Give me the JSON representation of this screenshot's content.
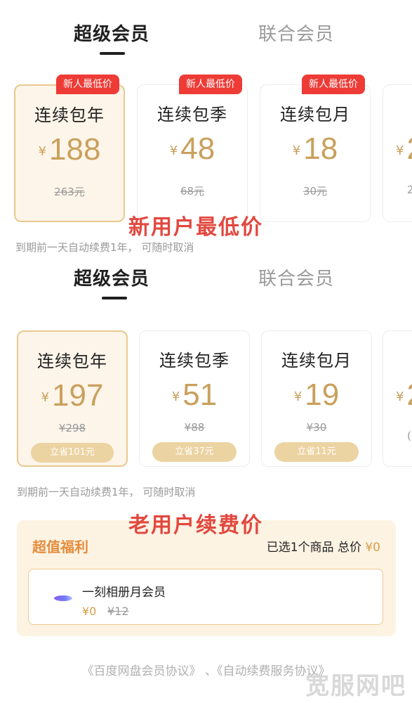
{
  "colors": {
    "gold": "#c9a05c",
    "badge_red": "#ee3b36",
    "overlay_red": "#e2483f",
    "selected_bg": "#fdf5e9",
    "benefit_bg": "#fdf3e3",
    "benefit_title": "#e58c3c"
  },
  "section_new": {
    "tabs": {
      "active": "超级会员",
      "inactive": "联合会员"
    },
    "badge": "新人最低价",
    "plans": [
      {
        "title": "连续包年",
        "currency": "¥",
        "price": "188",
        "original": "263元"
      },
      {
        "title": "连续包季",
        "currency": "¥",
        "price": "48",
        "original": "68元"
      },
      {
        "title": "连续包月",
        "currency": "¥",
        "price": "18",
        "original": "30元"
      },
      {
        "title": "",
        "currency": "¥",
        "price": "2",
        "original": "2"
      }
    ],
    "overlay_label": "新用户最低价",
    "note": "到期前一天自动续费1年， 可随时取消"
  },
  "section_old": {
    "tabs": {
      "active": "超级会员",
      "inactive": "联合会员"
    },
    "plans": [
      {
        "title": "连续包年",
        "currency": "¥",
        "price": "197",
        "original": "¥298",
        "save": "立省101元"
      },
      {
        "title": "连续包季",
        "currency": "¥",
        "price": "51",
        "original": "¥88",
        "save": "立省37元"
      },
      {
        "title": "连续包月",
        "currency": "¥",
        "price": "19",
        "original": "¥30",
        "save": "立省11元"
      },
      {
        "title": "",
        "currency": "¥",
        "price": "2",
        "original": "("
      }
    ],
    "note": "到期前一天自动续费1年， 可随时取消",
    "overlay_label": "老用户续费价"
  },
  "benefit": {
    "title": "超值福利",
    "summary_prefix": "已选1个商品 总价",
    "summary_total": "¥0",
    "item": {
      "icon": "album-logo-icon",
      "name": "一刻相册月会员",
      "price": "¥0",
      "original": "¥12"
    }
  },
  "footer": {
    "agreements": "《百度网盘会员协议》 、《自动续费服务协议》",
    "watermark": "宽服网吧"
  }
}
